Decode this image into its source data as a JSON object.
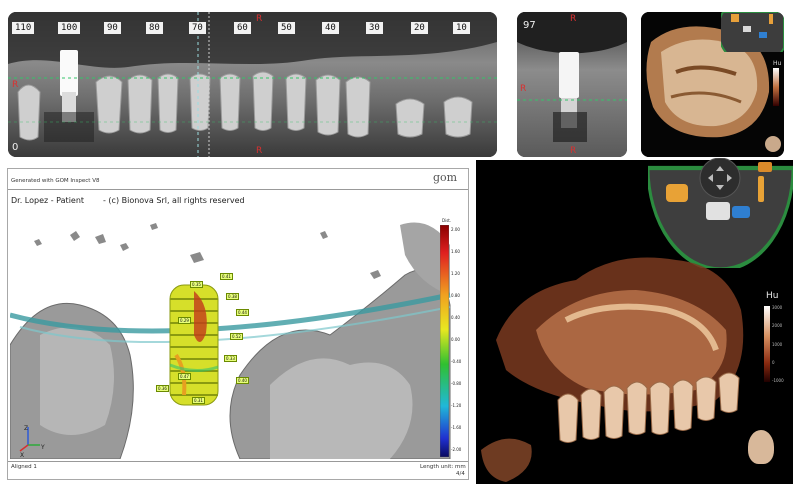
{
  "panorama": {
    "ruler_labels": [
      "110",
      "100",
      "90",
      "80",
      "70",
      "60",
      "50",
      "40",
      "30",
      "20",
      "10"
    ],
    "corner_value": "0",
    "red_markers": [
      "R",
      "R",
      "R"
    ]
  },
  "cross_section": {
    "slice_number": "97",
    "red_markers": [
      "R",
      "R",
      "R"
    ]
  },
  "report": {
    "header": "Generated with GOM Inspect V8",
    "logo": "gom",
    "patient": "Dr. Lopez - Patient",
    "copyright": "- (c) Bionova Srl, all rights reserved",
    "footer_left": "Aligned 1",
    "footer_right": "Length unit: mm",
    "page": "4/4",
    "legend_title": "Dist.",
    "legend_values": [
      "2.00",
      "1.60",
      "1.20",
      "0.80",
      "0.40",
      "0.00",
      "-0.40",
      "-0.80",
      "-1.20",
      "-1.60",
      "-2.00"
    ],
    "data_tags": [
      "0.35",
      "0.41",
      "0.38",
      "0.44",
      "0.29",
      "0.52",
      "0.33",
      "0.47",
      "0.36",
      "0.40",
      "0.31"
    ],
    "axes": [
      "Z",
      "X",
      "Y"
    ]
  },
  "volume": {
    "scale_label": "Hu",
    "scale_values": [
      "3000",
      "2000",
      "1000",
      "0",
      "-1000"
    ],
    "small_scale_label": "Hu"
  },
  "colors": {
    "accent_green": "#35c46a",
    "marker_red": "#d93030",
    "bone": "#d9b496",
    "implant_yellow": "#d6df2a"
  }
}
